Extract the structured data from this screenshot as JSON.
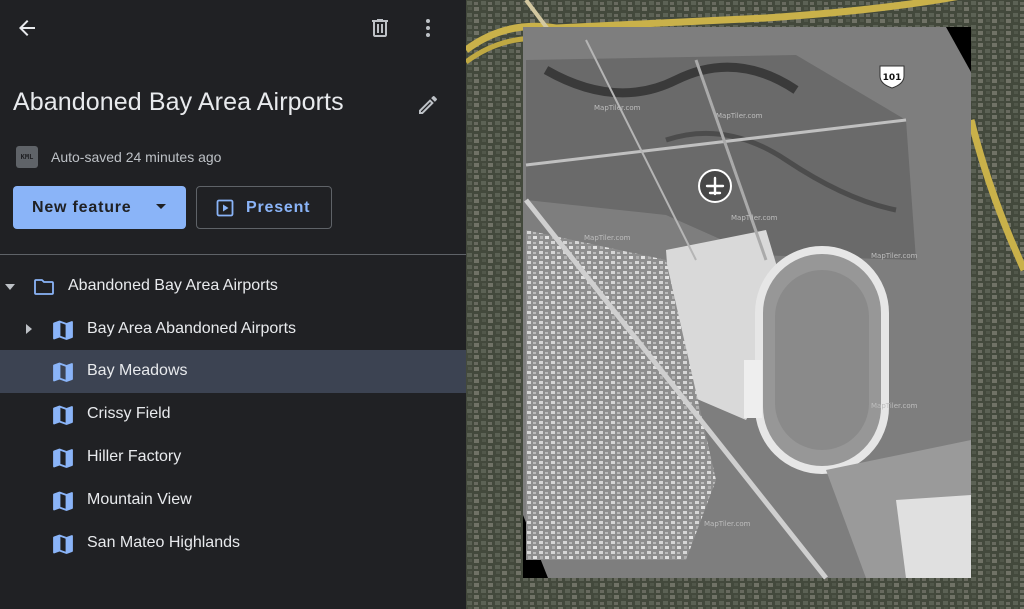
{
  "header": {
    "back_icon": "arrow-back-icon",
    "delete_icon": "trash-icon",
    "more_icon": "more-vert-icon",
    "edit_icon": "pencil-icon"
  },
  "project": {
    "title": "Abandoned Bay Area Airports",
    "status": "Auto-saved 24 minutes ago",
    "file_badge": "KML"
  },
  "actions": {
    "new_feature": "New feature",
    "present": "Present"
  },
  "tree": {
    "folder": {
      "label": "Abandoned Bay Area Airports",
      "icon": "folder-icon",
      "expanded": true
    },
    "items": [
      {
        "label": "Bay Area Abandoned Airports",
        "icon": "map-icon",
        "expandable": true,
        "selected": false
      },
      {
        "label": "Bay Meadows",
        "icon": "map-icon",
        "expandable": false,
        "selected": true
      },
      {
        "label": "Crissy Field",
        "icon": "map-icon",
        "expandable": false,
        "selected": false
      },
      {
        "label": "Hiller Factory",
        "icon": "map-icon",
        "expandable": false,
        "selected": false
      },
      {
        "label": "Mountain View",
        "icon": "map-icon",
        "expandable": false,
        "selected": false
      },
      {
        "label": "San Mateo Highlands",
        "icon": "map-icon",
        "expandable": false,
        "selected": false
      }
    ]
  },
  "map": {
    "highway_shield": "101",
    "marker_icon": "airplane-icon",
    "overlay_watermark": "MapTiler.com"
  },
  "colors": {
    "accent": "#8ab4f8",
    "panel_bg": "#202124",
    "selected_row": "#3c4352",
    "highway": "#c9b14a"
  }
}
